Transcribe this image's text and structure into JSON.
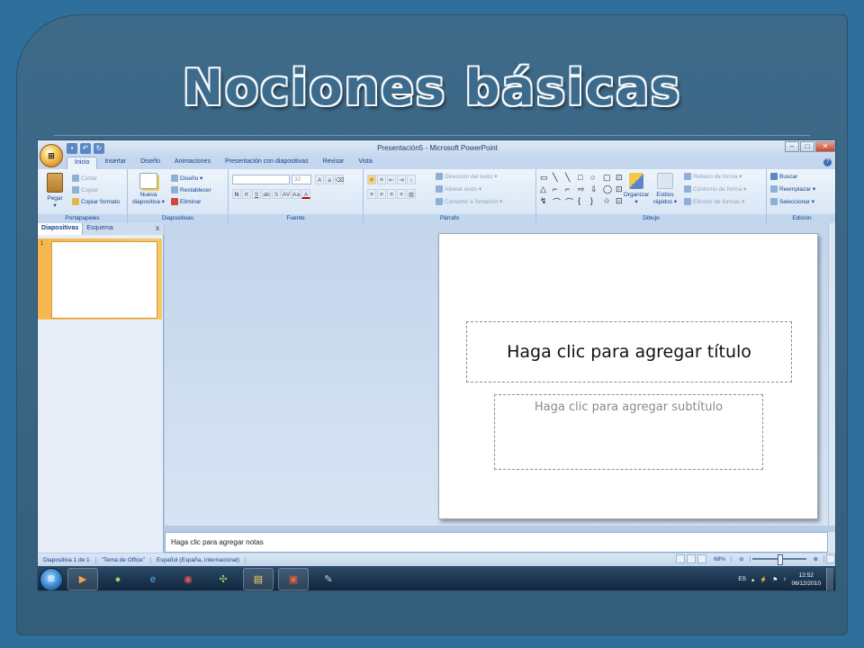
{
  "slide_title": "Nociones básicas",
  "window": {
    "title": "Presentación5 - Microsoft PowerPoint",
    "office_button": "",
    "controls": [
      "–",
      "□",
      "✕"
    ]
  },
  "ribbon_tabs": [
    "Inicio",
    "Insertar",
    "Diseño",
    "Animaciones",
    "Presentación con diapositivas",
    "Revisar",
    "Vista"
  ],
  "ribbon": {
    "portapapeles": {
      "label": "Portapapeles",
      "paste": "Pegar",
      "cut": "Cortar",
      "copy": "Copiar",
      "format": "Copiar formato"
    },
    "diapositivas": {
      "label": "Diapositivas",
      "new1": "Nueva",
      "new2": "diapositiva ▾",
      "design": "Diseño ▾",
      "reset": "Restablecer",
      "delete": "Eliminar"
    },
    "fuente": {
      "label": "Fuente",
      "font_name": "",
      "font_size": "32"
    },
    "parrafo": {
      "label": "Párrafo",
      "direction": "Dirección del texto ▾",
      "align": "Alinear texto ▾",
      "smartart": "Convertir a SmartArt ▾"
    },
    "dibujo": {
      "label": "Dibujo",
      "organize": "Organizar",
      "styles1": "Estilos",
      "styles2": "rápidos ▾",
      "fill": "Relleno de forma ▾",
      "outline": "Contorno de forma ▾",
      "effects": "Efectos de formas ▾"
    },
    "edicion": {
      "label": "Edición",
      "find": "Buscar",
      "replace": "Reemplazar ▾",
      "select": "Seleccionar ▾"
    }
  },
  "side_panel": {
    "tabs": [
      "Diapositivas",
      "Esquema"
    ],
    "close": "x",
    "slide_number": "1"
  },
  "slide": {
    "title_placeholder": "Haga clic para agregar título",
    "subtitle_placeholder": "Haga clic para agregar subtítulo"
  },
  "notes_placeholder": "Haga clic para agregar notas",
  "status": {
    "slide": "Diapositiva 1 de 1",
    "theme": "\"Tema de Office\"",
    "language": "Español (España, internacional)",
    "zoom": "68%"
  },
  "taskbar": {
    "language": "ES",
    "time": "12:52",
    "date": "06/12/2010"
  }
}
